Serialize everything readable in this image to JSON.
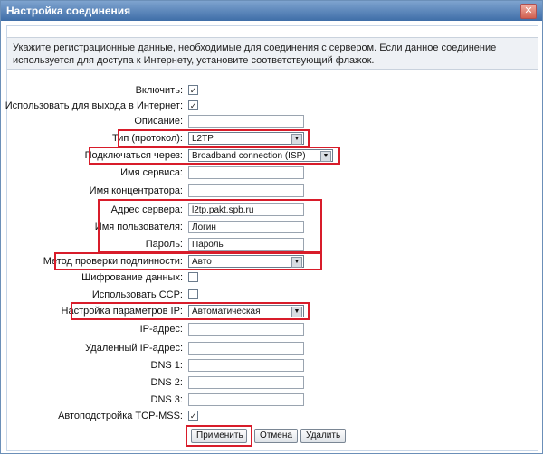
{
  "window": {
    "title": "Настройка соединения",
    "close_glyph": "✕"
  },
  "notice": "Укажите регистрационные данные, необходимые для соединения с сервером. Если данное соединение используется для доступа к Интернету, установите соответствующий флажок.",
  "fields": {
    "enable_label": "Включить:",
    "enable_checked": "✓",
    "internet_label": "Использовать для выхода в Интернет:",
    "internet_checked": "✓",
    "description_label": "Описание:",
    "description_value": "",
    "type_label": "Тип (протокол):",
    "type_value": "L2TP",
    "via_label": "Подключаться через:",
    "via_value": "Broadband connection (ISP)",
    "service_label": "Имя сервиса:",
    "service_value": "",
    "concentrator_label": "Имя концентратора:",
    "concentrator_value": "",
    "server_label": "Адрес сервера:",
    "server_value": "l2tp.pakt.spb.ru",
    "user_label": "Имя пользователя:",
    "user_value": "Логин",
    "password_label": "Пароль:",
    "password_value": "Пароль",
    "auth_label": "Метод проверки подлинности:",
    "auth_value": "Авто",
    "encrypt_label": "Шифрование данных:",
    "ccp_label": "Использовать CCP:",
    "ipcfg_label": "Настройка параметров IP:",
    "ipcfg_value": "Автоматическая",
    "ip_label": "IP-адрес:",
    "ip_value": "",
    "remote_ip_label": "Удаленный IP-адрес:",
    "remote_ip_value": "",
    "dns1_label": "DNS 1:",
    "dns1_value": "",
    "dns2_label": "DNS 2:",
    "dns2_value": "",
    "dns3_label": "DNS 3:",
    "dns3_value": "",
    "mss_label": "Автоподстройка TCP-MSS:",
    "mss_checked": "✓"
  },
  "buttons": {
    "apply": "Применить",
    "cancel": "Отмена",
    "delete": "Удалить"
  },
  "icons": {
    "dropdown": "chevron-down-icon"
  },
  "colors": {
    "title_bar": "#3f6ea8",
    "highlight": "#d81c2a"
  }
}
